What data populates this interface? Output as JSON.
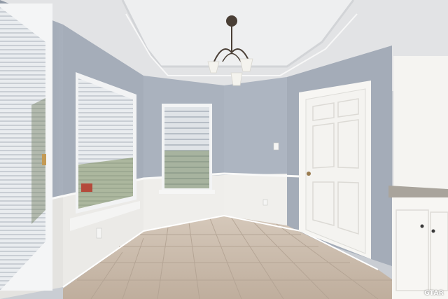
{
  "watermark": {
    "text": "GTAR"
  },
  "colors": {
    "wall": "#a9b1bd",
    "wainscot": "#efeeeb",
    "ceiling": "#e9eaeb",
    "floor_tile": "#cdbfb0",
    "door": "#f5f4f1",
    "countertop": "#a9a49c"
  }
}
